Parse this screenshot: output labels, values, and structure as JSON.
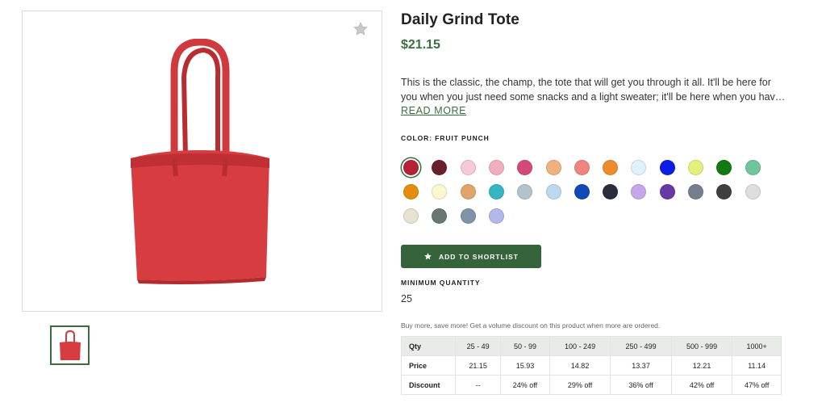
{
  "product": {
    "title": "Daily Grind Tote",
    "price": "$21.15",
    "description_line1": "This is the classic, the champ, the tote that will get you through it all. It'll be here for",
    "description_line2": "you when you just need some snacks and a light sweater; it'll be here when you hav…",
    "read_more": "READ MORE",
    "image_icon": "tote-bag",
    "favorite_icon": "star-icon"
  },
  "color": {
    "label": "COLOR: FRUIT PUNCH",
    "selected_index": 0,
    "swatches": [
      "#b52233",
      "#6b1f2a",
      "#f5c9d6",
      "#f3aebb",
      "#d6487a",
      "#efb27c",
      "#ee8580",
      "#ee8c2c",
      "#dff2fb",
      "#0a1ee6",
      "#e4ef7c",
      "#127a12",
      "#71c59b",
      "#e38d0c",
      "#fbf7cf",
      "#e0a56b",
      "#35b6c2",
      "#b4c2cd",
      "#bcd8ef",
      "#1248b8",
      "#2a2e3c",
      "#c6a7ea",
      "#6838a7",
      "#737f8d",
      "#3f3f3f",
      "#dedede",
      "#e7e2d1",
      "#697673",
      "#8192ac",
      "#b2b8ea"
    ]
  },
  "shortlist": {
    "label": "ADD TO SHORTLIST",
    "icon": "star-icon"
  },
  "minimum_quantity": {
    "label": "MINIMUM QUANTITY",
    "value": "25"
  },
  "volume": {
    "note": "Buy more, save more! Get a volume discount on this product when more are ordered.",
    "qty_header": "Qty",
    "price_header": "Price",
    "discount_header": "Discount",
    "tiers": [
      {
        "qty": "25 - 49",
        "price": "21.15",
        "discount": "--"
      },
      {
        "qty": "50 - 99",
        "price": "15.93",
        "discount": "24% off"
      },
      {
        "qty": "100 - 249",
        "price": "14.82",
        "discount": "29% off"
      },
      {
        "qty": "250 - 499",
        "price": "13.37",
        "discount": "36% off"
      },
      {
        "qty": "500 - 999",
        "price": "12.21",
        "discount": "42% off"
      },
      {
        "qty": "1000+",
        "price": "11.14",
        "discount": "47% off"
      }
    ]
  },
  "colors": {
    "accent": "#3b6e3f",
    "button": "#35643a",
    "bag": "#d63c40"
  }
}
